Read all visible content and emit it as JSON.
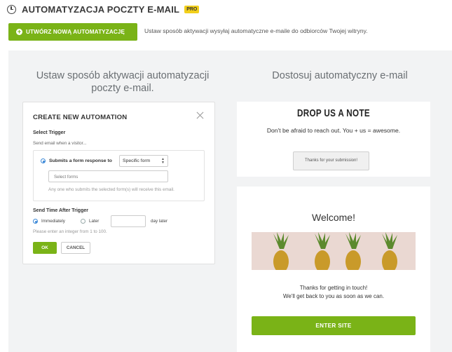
{
  "header": {
    "title": "AUTOMATYZACJA POCZTY E-MAIL",
    "badge": "PRO"
  },
  "toolbar": {
    "create_label": "UTWÓRZ NOWĄ AUTOMATYZACJĘ",
    "description": "Ustaw sposób aktywacji wysyłaj automatyczne e-maile do odbiorców Twojej witryny."
  },
  "left_column": {
    "heading_line1": "Ustaw sposób aktywacji automatyzacji",
    "heading_line2": "poczty e-mail."
  },
  "right_column": {
    "heading": "Dostosuj automatyczny e-mail"
  },
  "automation_form": {
    "title": "CREATE NEW AUTOMATION",
    "select_trigger_label": "Select Trigger",
    "trigger_hint": "Send email when a visitor...",
    "trigger_option_label": "Submits a form response to",
    "trigger_select_value": "Specific form",
    "forms_placeholder": "Select forms",
    "forms_note": "Any one who submits the selected form(s) will receive this email.",
    "send_time_label": "Send Time After Trigger",
    "immediately_label": "Immediately",
    "later_label": "Later",
    "later_input_value": "",
    "day_later_label": "day later",
    "integer_hint": "Please enter an integer  from 1 to 100.",
    "ok_label": "OK",
    "cancel_label": "CANCEL"
  },
  "preview_note": {
    "title": "DROP US A NOTE",
    "subtitle": "Don't be afraid to reach out. You + us = awesome.",
    "button_label": "Thanks for your submission!"
  },
  "preview_welcome": {
    "title": "Welcome!",
    "line1": "Thanks for getting in touch!",
    "line2": "We'll get back to you as soon as we can.",
    "button_label": "ENTER SITE"
  },
  "colors": {
    "accent_green": "#7ab317",
    "pro_badge": "#f2cf1b",
    "panel_bg": "#f2f3f4",
    "radio_blue": "#3a87d7"
  },
  "icons": {
    "header": "clock-icon",
    "create": "plus-circle-icon",
    "close": "close-icon",
    "select": "chevron-updown-icon"
  }
}
